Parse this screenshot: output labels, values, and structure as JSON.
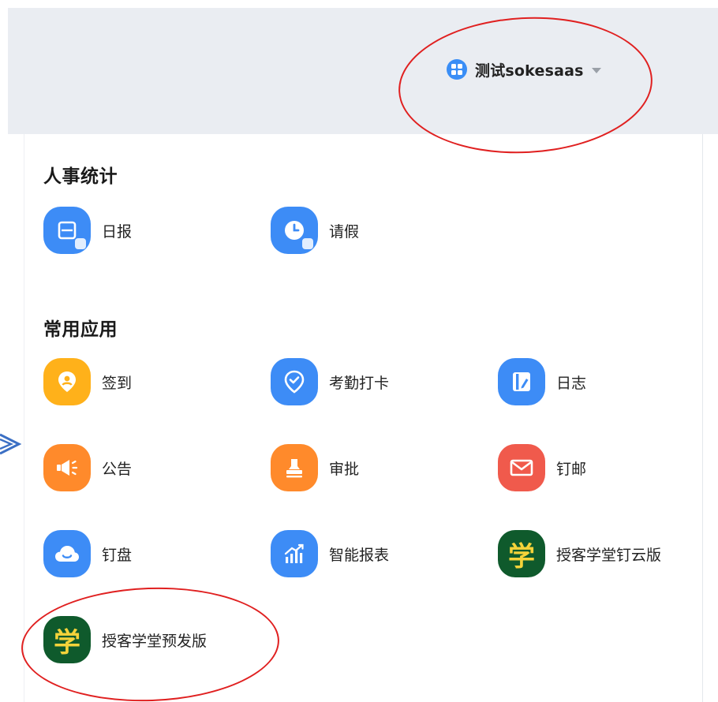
{
  "header": {
    "org_name": "测试sokesaas"
  },
  "sections": [
    {
      "title": "人事统计",
      "apps": [
        {
          "label": "日报",
          "icon": "daily-report-icon"
        },
        {
          "label": "请假",
          "icon": "leave-clock-icon"
        }
      ]
    },
    {
      "title": "常用应用",
      "apps": [
        {
          "label": "签到",
          "icon": "checkin-location-icon"
        },
        {
          "label": "考勤打卡",
          "icon": "attendance-check-icon"
        },
        {
          "label": "日志",
          "icon": "log-book-icon"
        },
        {
          "label": "公告",
          "icon": "announcement-megaphone-icon"
        },
        {
          "label": "审批",
          "icon": "approval-stamp-icon"
        },
        {
          "label": "钉邮",
          "icon": "mail-envelope-icon"
        },
        {
          "label": "钉盘",
          "icon": "cloud-drive-icon"
        },
        {
          "label": "智能报表",
          "icon": "report-chart-icon"
        },
        {
          "label": "授客学堂钉云版",
          "icon": "xue-academy-icon",
          "glyph": "学"
        },
        {
          "label": "授客学堂预发版",
          "icon": "xue-academy-icon",
          "glyph": "学"
        }
      ]
    }
  ],
  "colors": {
    "header_bg": "#eaedf2",
    "brand_blue": "#3d8cf6",
    "yellow": "#ffb11a",
    "orange": "#ff8a2b",
    "red": "#f05a4c",
    "academy_green": "#0f5a2c",
    "annotation_red": "#e02020",
    "arrow_blue": "#3b6fc4"
  }
}
